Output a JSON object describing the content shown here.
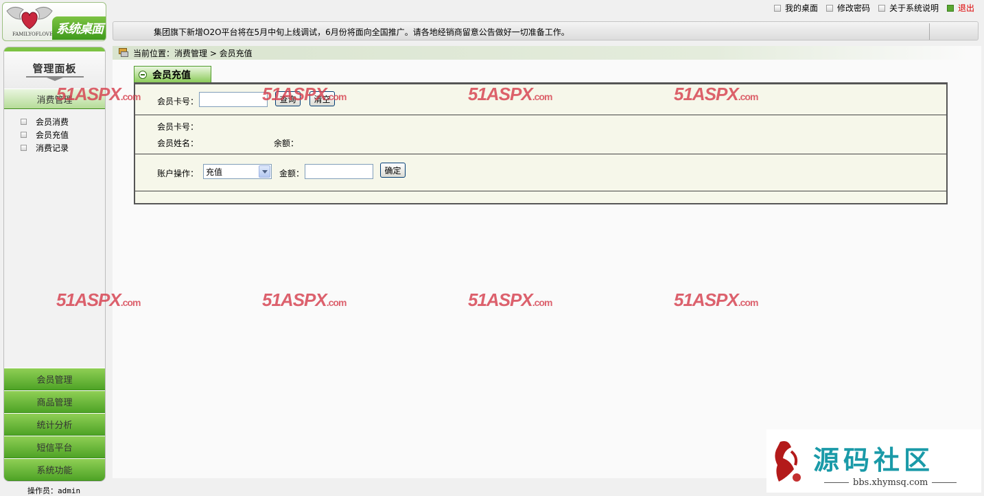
{
  "header": {
    "logo_main": "系统桌面",
    "logo_sub": "FAMILYOFLOVE",
    "links": [
      {
        "label": "我的桌面"
      },
      {
        "label": "修改密码"
      },
      {
        "label": "关于系统说明"
      },
      {
        "label": "退出"
      }
    ],
    "notice": "集团旗下新增O2O平台将在5月中旬上线调试，6月份将面向全国推广。请各地经销商留意公告做好一切准备工作。"
  },
  "sidebar": {
    "title": "管理面板",
    "active_menu": "消费管理",
    "sub_items": [
      {
        "label": "会员消费"
      },
      {
        "label": "会员充值"
      },
      {
        "label": "消费记录"
      }
    ],
    "menus": [
      {
        "label": "会员管理"
      },
      {
        "label": "商品管理"
      },
      {
        "label": "统计分析"
      },
      {
        "label": "短信平台"
      },
      {
        "label": "系统功能"
      }
    ],
    "operator": "操作员：admin"
  },
  "breadcrumb": "当前位置：消费管理 > 会员充值",
  "panel": {
    "title": "会员充值",
    "search": {
      "card_label": "会员卡号：",
      "card_value": "",
      "query_label": "查询",
      "clear_label": "清空"
    },
    "info": {
      "card_label": "会员卡号：",
      "name_label": "会员姓名：",
      "balance_label": "余额："
    },
    "op": {
      "op_label": "账户操作：",
      "op_selected": "充值",
      "amount_label": "金额：",
      "amount_value": "",
      "confirm_label": "确定"
    }
  },
  "watermark": {
    "main": "51ASPX",
    "suffix": ".com"
  },
  "badge": {
    "title": "源码社区",
    "url": "bbs.xhymsq.com"
  },
  "colors": {
    "accent_green": "#5aa832",
    "watermark_red": "#d6404e",
    "badge_teal": "#1a9aa8"
  }
}
